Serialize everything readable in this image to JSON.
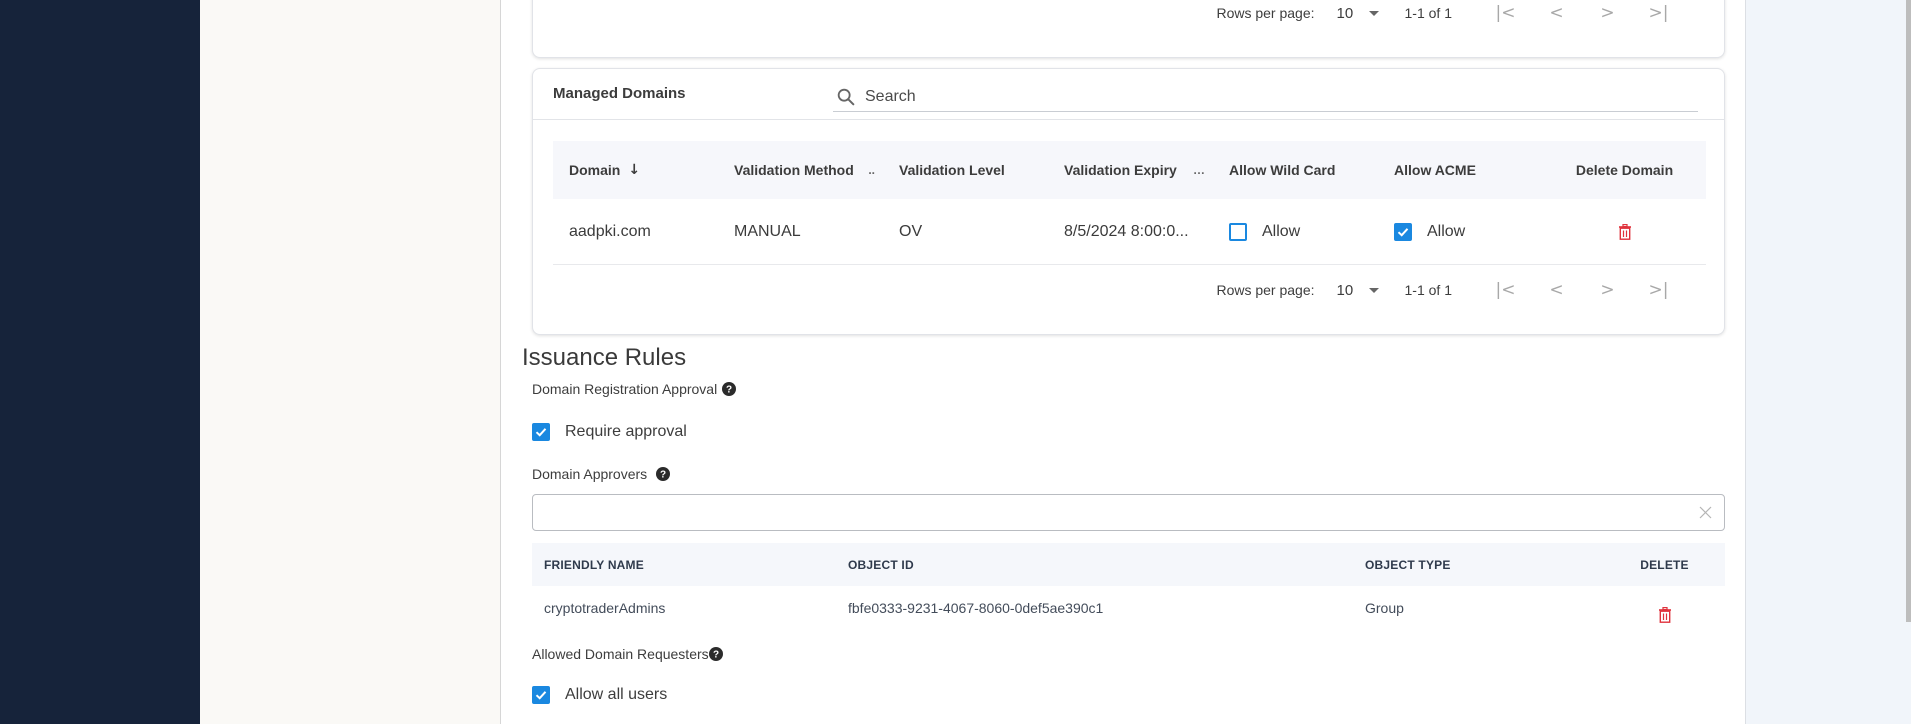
{
  "top_card": {
    "pager": {
      "rows_per_page_label": "Rows per page:",
      "rows_per_page_value": "10",
      "range": "1-1 of 1",
      "first_icon": "first-page-icon",
      "prev_icon": "chevron-left-icon",
      "next_icon": "chevron-right-icon",
      "last_icon": "last-page-icon"
    }
  },
  "managed_domains": {
    "title": "Managed Domains",
    "search": {
      "placeholder": "Search",
      "value": "",
      "icon": "search-icon"
    },
    "columns": [
      {
        "label": "Domain",
        "sorted": "desc"
      },
      {
        "label": "Validation Method"
      },
      {
        "label": "Validation Level"
      },
      {
        "label": "Validation Expiry"
      },
      {
        "label": "Allow Wild Card"
      },
      {
        "label": "Allow ACME"
      },
      {
        "label": "Delete Domain"
      }
    ],
    "rows": [
      {
        "domain": "aadpki.com",
        "validation_method": "MANUAL",
        "validation_level": "OV",
        "validation_expiry": "8/5/2024 8:00:0...",
        "allow_wild_card": {
          "checked": false,
          "label": "Allow"
        },
        "allow_acme": {
          "checked": true,
          "label": "Allow"
        },
        "delete_icon": "trash-icon"
      }
    ],
    "pager": {
      "rows_per_page_label": "Rows per page:",
      "rows_per_page_value": "10",
      "range": "1-1 of 1"
    }
  },
  "issuance_rules": {
    "title": "Issuance Rules",
    "registration_approval": {
      "label": "Domain Registration Approval",
      "checkbox_label": "Require approval",
      "checked": true
    },
    "approvers": {
      "label": "Domain Approvers",
      "input_value": "",
      "columns": [
        "FRIENDLY NAME",
        "OBJECT ID",
        "OBJECT TYPE",
        "DELETE"
      ],
      "rows": [
        {
          "friendly_name": "cryptotraderAdmins",
          "object_id": "fbfe0333-9231-4067-8060-0def5ae390c1",
          "object_type": "Group"
        }
      ]
    },
    "requesters": {
      "label": "Allowed Domain Requesters",
      "checkbox_label": "Allow all users",
      "checked": true
    }
  },
  "colors": {
    "sidebar": "#16233a",
    "accent": "#1a88e0",
    "danger": "#e0323c"
  }
}
